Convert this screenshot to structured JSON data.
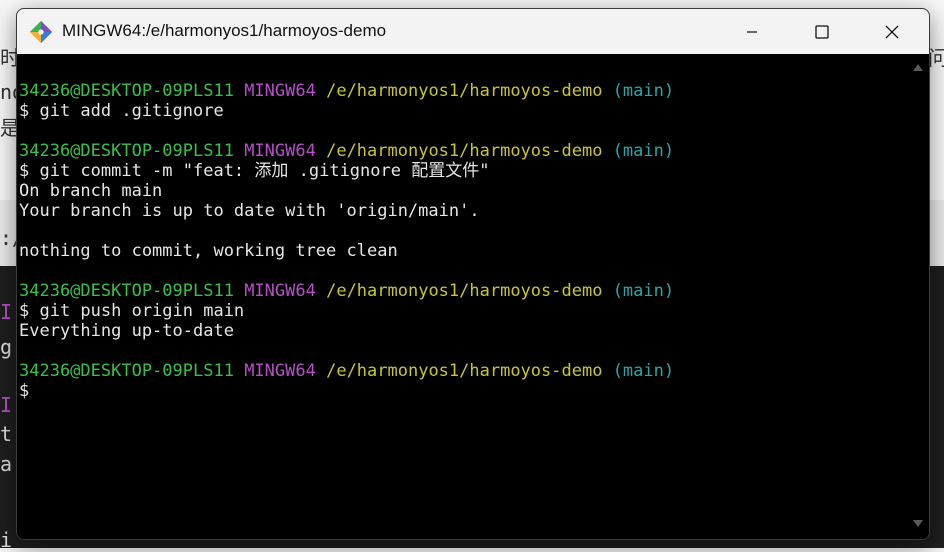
{
  "background": {
    "fragments_top": [
      "时",
      "no",
      "是"
    ],
    "fragment_right": "问",
    "fragment_mid": ":/",
    "fragments_dark": [
      "I",
      "g",
      "I",
      "t",
      "a",
      "i"
    ]
  },
  "window": {
    "title": "MINGW64:/e/harmonyos1/harmoyos-demo",
    "icon": "git-diamond-icon"
  },
  "colors": {
    "user": "#3ac04a",
    "system": "#b84fc8",
    "path": "#c7c43a",
    "branch": "#2aa6a6",
    "text": "#e6e6e6"
  },
  "terminal": {
    "lines": [
      {
        "type": "prompt",
        "user": "34236@DESKTOP-09PLS11",
        "system": "MINGW64",
        "path": "/e/harmonyos1/harmoyos-demo",
        "branch": "(main)"
      },
      {
        "type": "text",
        "text": "$ git add .gitignore"
      },
      {
        "type": "blank",
        "text": ""
      },
      {
        "type": "prompt",
        "user": "34236@DESKTOP-09PLS11",
        "system": "MINGW64",
        "path": "/e/harmonyos1/harmoyos-demo",
        "branch": "(main)"
      },
      {
        "type": "text",
        "text": "$ git commit -m \"feat: 添加 .gitignore 配置文件\""
      },
      {
        "type": "text",
        "text": "On branch main"
      },
      {
        "type": "text",
        "text": "Your branch is up to date with 'origin/main'."
      },
      {
        "type": "blank",
        "text": ""
      },
      {
        "type": "text",
        "text": "nothing to commit, working tree clean"
      },
      {
        "type": "blank",
        "text": ""
      },
      {
        "type": "prompt",
        "user": "34236@DESKTOP-09PLS11",
        "system": "MINGW64",
        "path": "/e/harmonyos1/harmoyos-demo",
        "branch": "(main)"
      },
      {
        "type": "text",
        "text": "$ git push origin main"
      },
      {
        "type": "text",
        "text": "Everything up-to-date"
      },
      {
        "type": "blank",
        "text": ""
      },
      {
        "type": "prompt",
        "user": "34236@DESKTOP-09PLS11",
        "system": "MINGW64",
        "path": "/e/harmonyos1/harmoyos-demo",
        "branch": "(main)"
      },
      {
        "type": "text",
        "text": "$"
      }
    ]
  }
}
